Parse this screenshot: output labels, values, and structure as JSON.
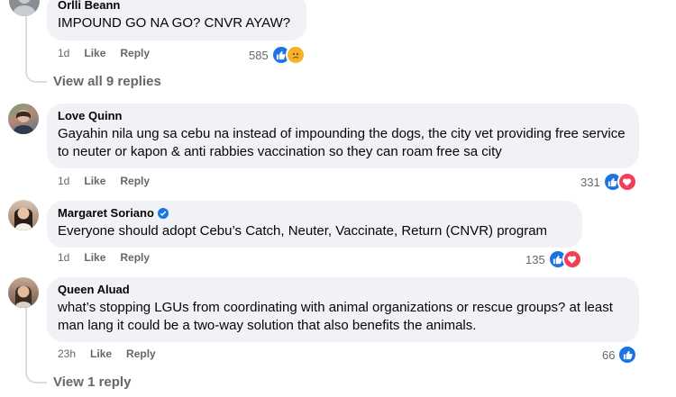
{
  "comments": [
    {
      "name": "Orlli Beann",
      "text": "IMPOUND GO NA GO? CNVR AYAW?",
      "time": "1d",
      "like_label": "Like",
      "reply_label": "Reply",
      "reaction_count": "585",
      "reactions": [
        "like-icon",
        "sad-icon"
      ],
      "view_replies": "View all 9 replies"
    },
    {
      "name": "Love Quinn",
      "text": "Gayahin nila ung sa cebu na instead of impounding the dogs, the city vet providing free service to neuter or kapon & anti rabbies vaccination so they can roam free sa city",
      "time": "1d",
      "like_label": "Like",
      "reply_label": "Reply",
      "reaction_count": "331",
      "reactions": [
        "like-icon",
        "love-icon"
      ]
    },
    {
      "name": "Margaret Soriano",
      "verified": true,
      "text": "Everyone should adopt Cebu’s Catch, Neuter, Vaccinate, Return (CNVR) program",
      "time": "1d",
      "like_label": "Like",
      "reply_label": "Reply",
      "reaction_count": "135",
      "reactions": [
        "like-icon",
        "love-icon"
      ]
    },
    {
      "name": "Queen Aluad",
      "text": "what’s stopping LGUs from coordinating with animal organizations or rescue groups? at least man lang it could be a two-way solution that also benefits the animals.",
      "time": "23h",
      "like_label": "Like",
      "reply_label": "Reply",
      "reaction_count": "66",
      "reactions": [
        "like-icon"
      ],
      "view_replies": "View 1 reply"
    }
  ],
  "colors": {
    "bubble": "#f0f2f5",
    "like": "#1b74e4",
    "love": "#f33e58",
    "sad": "#f7b125",
    "meta": "#65676b"
  }
}
